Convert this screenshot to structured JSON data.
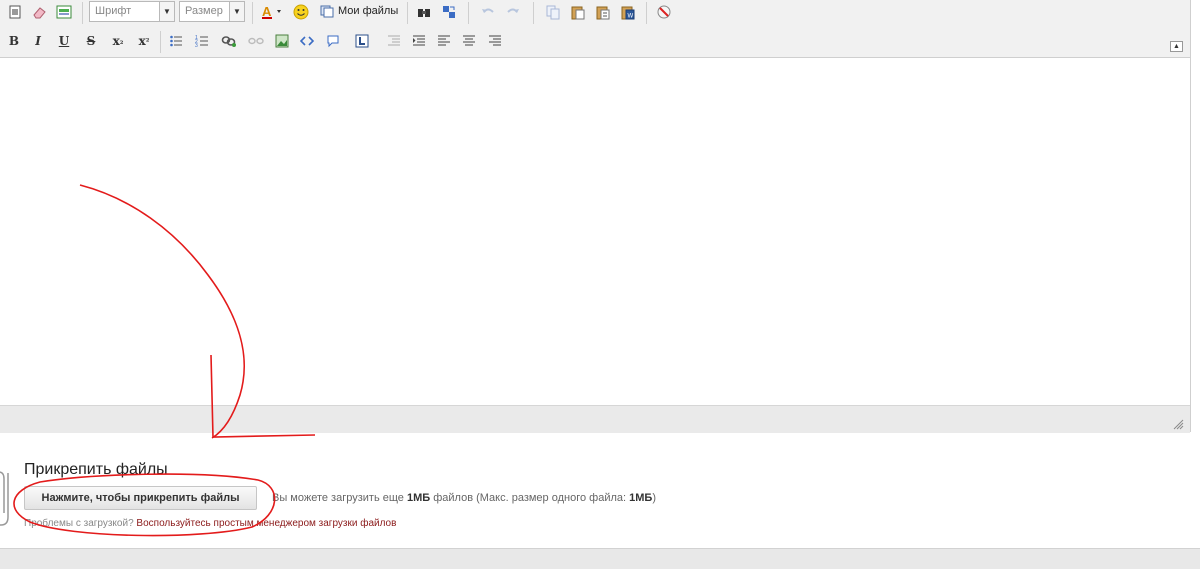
{
  "toolbar": {
    "font_combo": "Шрифт",
    "size_combo": "Размер",
    "my_files": "Мои файлы"
  },
  "format_bar": {
    "bold": "B",
    "italic": "I",
    "underline": "U",
    "strike": "S",
    "subscript_base": "x",
    "subscript_mark": "₂",
    "superscript_base": "x",
    "superscript_mark": "²"
  },
  "attach": {
    "title": "Прикрепить файлы",
    "button": "Нажмите, чтобы прикрепить файлы",
    "info_prefix": "Вы можете загрузить еще",
    "info_limit": "1МБ",
    "info_middle": "файлов (Макс. размер одного файла:",
    "info_max": "1МБ",
    "info_suffix": ")",
    "problems_text": "Проблемы с загрузкой?",
    "problems_link": "Воспользуйтесь простым менеджером загрузки файлов"
  },
  "colors": {
    "annotation": "#e31b1b",
    "link": "#8b1a1a",
    "toolbar_bg": "#f1f1f1"
  }
}
